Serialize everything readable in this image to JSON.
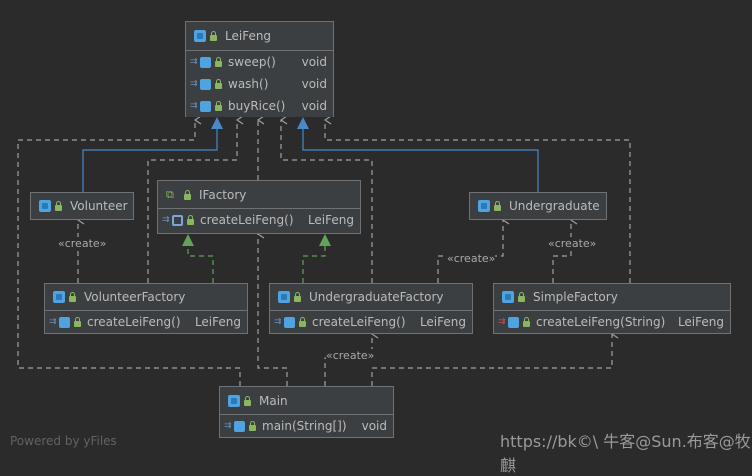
{
  "nodes": {
    "leifeng": {
      "title": "LeiFeng",
      "members": [
        {
          "name": "sweep()",
          "type": "void"
        },
        {
          "name": "wash()",
          "type": "void"
        },
        {
          "name": "buyRice()",
          "type": "void"
        }
      ]
    },
    "volunteer": {
      "title": "Volunteer"
    },
    "ifactory": {
      "title": "IFactory",
      "members": [
        {
          "name": "createLeiFeng()",
          "type": "LeiFeng"
        }
      ]
    },
    "undergraduate": {
      "title": "Undergraduate"
    },
    "volunteer_factory": {
      "title": "VolunteerFactory",
      "members": [
        {
          "name": "createLeiFeng()",
          "type": "LeiFeng"
        }
      ]
    },
    "undergraduate_factory": {
      "title": "UndergraduateFactory",
      "members": [
        {
          "name": "createLeiFeng()",
          "type": "LeiFeng"
        }
      ]
    },
    "simple_factory": {
      "title": "SimpleFactory",
      "members": [
        {
          "name": "createLeiFeng(String)",
          "type": "LeiFeng"
        }
      ]
    },
    "main": {
      "title": "Main",
      "members": [
        {
          "name": "main(String[])",
          "type": "void"
        }
      ]
    }
  },
  "edge_labels": {
    "create_1": "«create»",
    "create_2": "«create»",
    "create_3": "«create»",
    "create_4": "«create»"
  },
  "footer": {
    "powered_by": "Powered by yFiles"
  },
  "watermark": "https://bk©\\ 牛客@Sun.布客@牧麒"
}
